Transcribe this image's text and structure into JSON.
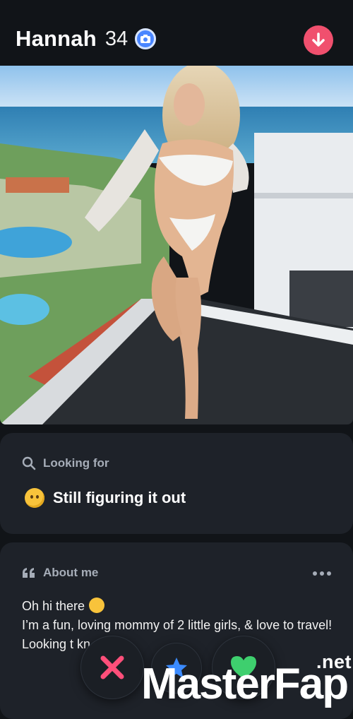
{
  "profile": {
    "name": "Hannah",
    "age": "34"
  },
  "looking_for": {
    "label": "Looking for",
    "value": "Still figuring it out"
  },
  "about": {
    "label": "About me",
    "line1": "Oh hi there",
    "line2": "I’m a fun, loving mommy of 2 little girls, & love to travel!",
    "line3": "Looking t     kn     w"
  },
  "watermark": {
    "part1": "Master",
    "part2": "Fap",
    "suffix": ".net"
  },
  "colors": {
    "background": "#111418",
    "card": "#1e2229",
    "accent_pink": "#f0506e",
    "verified_blue": "#4a86ff",
    "like_green": "#3ecf6e",
    "nope_pink": "#ff4f7a",
    "superlike_blue": "#3b8bff"
  },
  "icons": [
    "verified-badge-icon",
    "arrow-down-icon",
    "search-icon",
    "quote-icon",
    "more-icon",
    "thinking-emoji-icon",
    "smile-emoji-icon",
    "close-icon",
    "star-icon",
    "heart-icon"
  ]
}
